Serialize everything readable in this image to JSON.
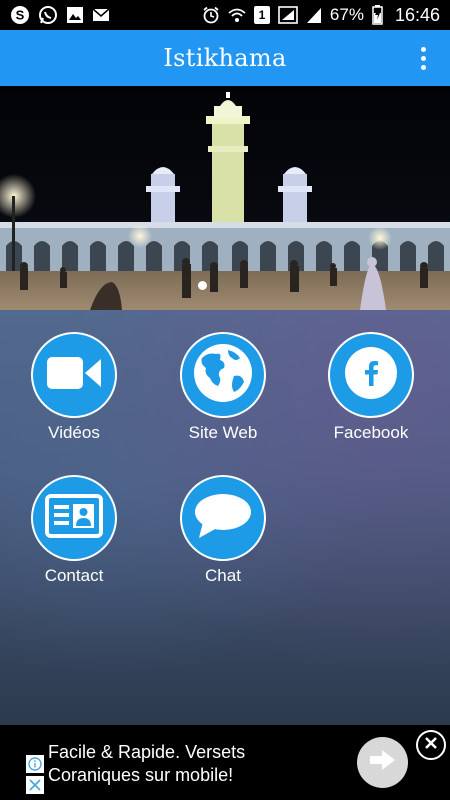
{
  "status_bar": {
    "battery": "67%",
    "time": "16:46",
    "notification_icons": [
      "skype-icon",
      "whatsapp-icon",
      "image-icon",
      "email-icon"
    ],
    "system_icons": [
      "alarm-icon",
      "wifi-icon",
      "sim-1-icon",
      "signal-icon",
      "battery-icon"
    ],
    "sim_label": "1"
  },
  "app_bar": {
    "title": "Istikhama",
    "menu_icon": "overflow-menu-icon"
  },
  "banner": {
    "image": "mosque-at-night",
    "pager_active": 1
  },
  "menu": {
    "items": [
      {
        "label": "Vidéos",
        "icon": "video-camera-icon"
      },
      {
        "label": "Site Web",
        "icon": "globe-icon"
      },
      {
        "label": "Facebook",
        "icon": "facebook-icon"
      },
      {
        "label": "Contact",
        "icon": "contact-card-icon"
      },
      {
        "label": "Chat",
        "icon": "chat-bubble-icon"
      }
    ],
    "accent": "#1d9be6"
  },
  "ad": {
    "line1": "Facile & Rapide. Versets",
    "line2": "Coraniques sur mobile!"
  },
  "colors": {
    "app_bar": "#2196f3",
    "tile": "#1d9be6"
  }
}
